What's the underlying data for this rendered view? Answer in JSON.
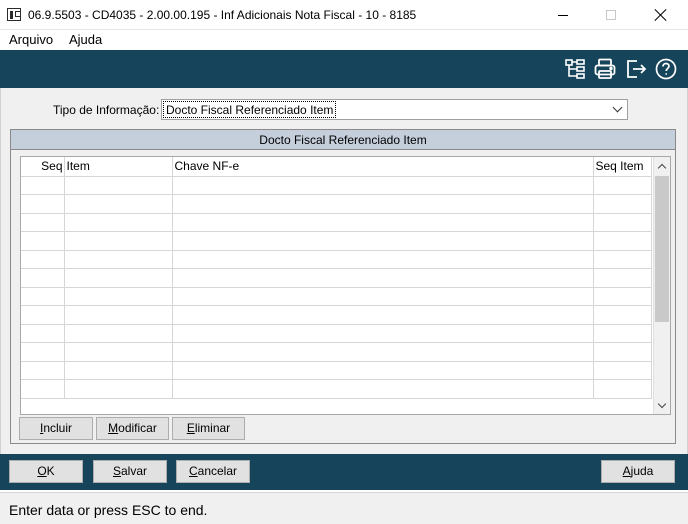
{
  "window": {
    "title": "06.9.5503 - CD4035 - 2.00.00.195 - Inf Adicionais Nota Fiscal - 10 - 8185"
  },
  "menu": {
    "items": [
      "Arquivo",
      "Ajuda"
    ]
  },
  "toolbar": {
    "icons": [
      "tree-structure-icon",
      "printer-icon",
      "exit-icon",
      "help-icon"
    ],
    "background": "#16445a"
  },
  "form": {
    "tipo_label": "Tipo de Informação:",
    "tipo_value": "Docto Fiscal Referenciado Item"
  },
  "panel": {
    "title": "Docto Fiscal Referenciado Item",
    "header_color": "#c5cedb",
    "columns": [
      "Seq",
      "Item",
      "Chave NF-e",
      "Seq Item"
    ],
    "rows": [
      [
        "",
        "",
        "",
        ""
      ],
      [
        "",
        "",
        "",
        ""
      ],
      [
        "",
        "",
        "",
        ""
      ],
      [
        "",
        "",
        "",
        ""
      ],
      [
        "",
        "",
        "",
        ""
      ],
      [
        "",
        "",
        "",
        ""
      ],
      [
        "",
        "",
        "",
        ""
      ],
      [
        "",
        "",
        "",
        ""
      ],
      [
        "",
        "",
        "",
        ""
      ],
      [
        "",
        "",
        "",
        ""
      ],
      [
        "",
        "",
        "",
        ""
      ],
      [
        "",
        "",
        "",
        ""
      ]
    ],
    "buttons": {
      "incluir": "Incluir",
      "modificar": "Modificar",
      "eliminar": "Eliminar"
    }
  },
  "actions": {
    "ok": "OK",
    "salvar": "Salvar",
    "cancelar": "Cancelar",
    "ajuda": "Ajuda"
  },
  "status": {
    "text": "Enter data or press ESC to end."
  }
}
